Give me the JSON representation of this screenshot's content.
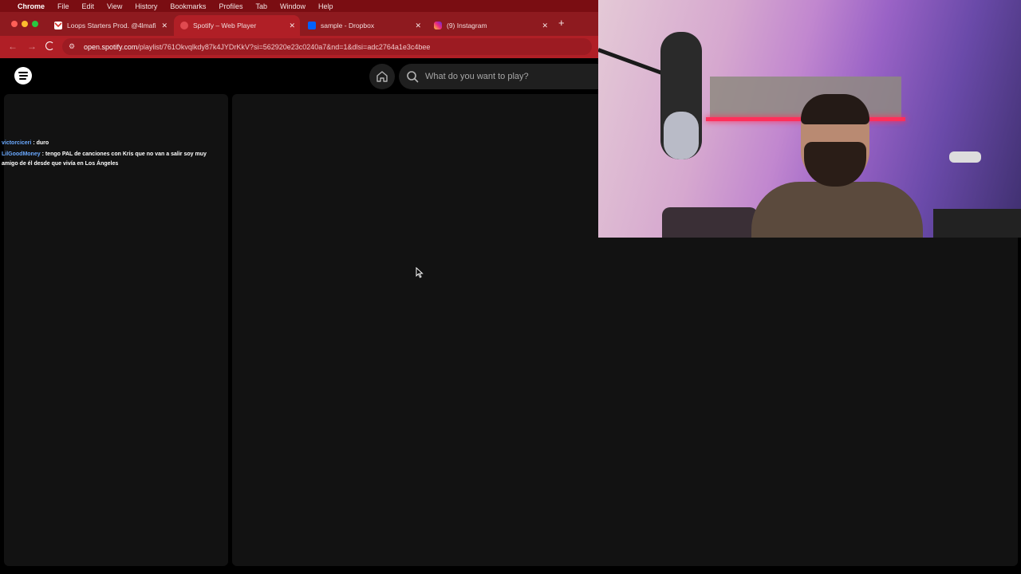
{
  "menubar": {
    "app": "Chrome",
    "items": [
      "File",
      "Edit",
      "View",
      "History",
      "Bookmarks",
      "Profiles",
      "Tab",
      "Window",
      "Help"
    ]
  },
  "tabs": [
    {
      "title": "Loops Starters Prod. @4lmafi",
      "icon": "gmail-icon",
      "active": false
    },
    {
      "title": "Spotify – Web Player",
      "icon": "spotify-icon",
      "active": true
    },
    {
      "title": "sample - Dropbox",
      "icon": "dropbox-icon",
      "active": false
    },
    {
      "title": "(9) Instagram",
      "icon": "instagram-icon",
      "active": false
    }
  ],
  "address": {
    "host": "open.spotify.com",
    "path": "/playlist/761Okvqlkdy87k4JYDrKkV?si=562920e23c0240a7&nd=1&dlsi=adc2764a1e3c4bee"
  },
  "spotify": {
    "search_placeholder": "What do you want to play?"
  },
  "chat": [
    {
      "user": "victorciceri",
      "message": ": duro"
    },
    {
      "user": "LilGoodMoney",
      "message": ": tengo PAL de canciones con Kris que no van a salir soy muy amigo de él desde que vivía en Los Ángeles"
    }
  ],
  "colors": {
    "menubar": "#7a0d12",
    "tabstrip": "#8e1a1f",
    "toolbar": "#b01f26",
    "panel": "#121212",
    "chat_user": "#6aa9ff"
  }
}
